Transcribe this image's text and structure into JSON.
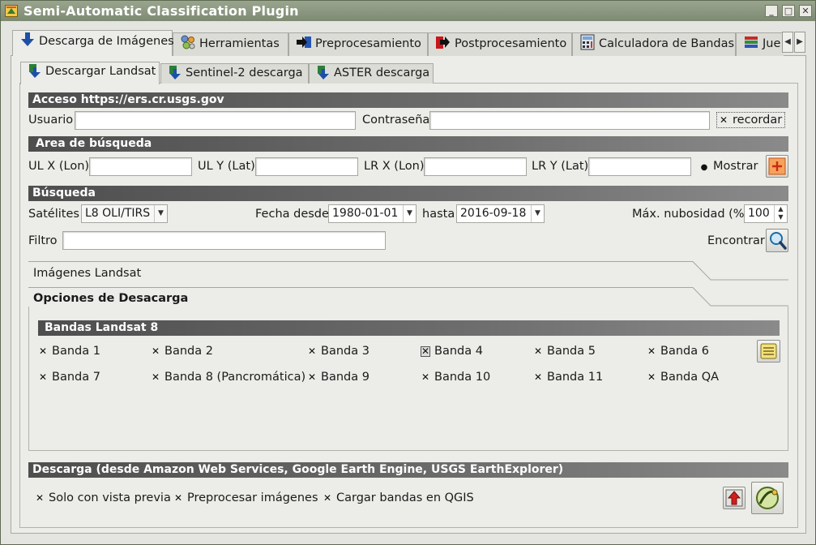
{
  "window": {
    "title": "Semi-Automatic Classification Plugin",
    "controls": [
      "_",
      "□",
      "✕"
    ]
  },
  "main_tabs": [
    {
      "label": "Descarga de Imágenes",
      "icon": "download-arrow-icon",
      "active": true
    },
    {
      "label": "Herramientas",
      "icon": "tools-icon"
    },
    {
      "label": "Preprocesamiento",
      "icon": "preprocessing-icon"
    },
    {
      "label": "Postprocesamiento",
      "icon": "postprocessing-icon"
    },
    {
      "label": "Calculadora de Bandas",
      "icon": "calculator-icon"
    },
    {
      "label": "Jue",
      "icon": "band-set-icon"
    }
  ],
  "sub_tabs": [
    {
      "label": "Descargar Landsat",
      "active": true
    },
    {
      "label": "Sentinel-2 descarga"
    },
    {
      "label": "ASTER descarga"
    }
  ],
  "access": {
    "header": "Acceso https://ers.cr.usgs.gov",
    "user_label": "Usuario",
    "user_value": "",
    "password_label": "Contraseña",
    "password_value": "",
    "remember_label": "recordar",
    "remember_checked": true
  },
  "search_area": {
    "header": "Area de búsqueda",
    "ulx_label": "UL X (Lon)",
    "uly_label": "UL Y (Lat)",
    "lrx_label": "LR X (Lon)",
    "lry_label": "LR Y (Lat)",
    "show_label": "Mostrar"
  },
  "search": {
    "header": "Búsqueda",
    "satellites_label": "Satélites",
    "satellite_value": "L8 OLI/TIRS",
    "date_from_label": "Fecha desde",
    "date_from_value": "1980-01-01",
    "until_label": "hasta",
    "until_value": "2016-09-18",
    "cloud_label": "Máx. nubosidad (%)",
    "cloud_value": "100",
    "filter_label": "Filtro",
    "filter_value": "",
    "find_label": "Encontrar"
  },
  "collapsibles": {
    "images_label": "Imágenes Landsat",
    "options_label": "Opciones de Desacarga"
  },
  "bands": {
    "header": "Bandas Landsat 8",
    "row1": [
      {
        "label": "Banda 1",
        "checked": true
      },
      {
        "label": "Banda 2",
        "checked": true
      },
      {
        "label": "Banda 3",
        "checked": true
      },
      {
        "label": "Banda 4",
        "checked": true,
        "focused": true
      },
      {
        "label": "Banda 5",
        "checked": true
      },
      {
        "label": "Banda 6",
        "checked": true
      }
    ],
    "row2": [
      {
        "label": "Banda 7",
        "checked": true
      },
      {
        "label": "Banda 8 (Pancromática)",
        "checked": true
      },
      {
        "label": "Banda 9",
        "checked": true
      },
      {
        "label": "Banda 10",
        "checked": true
      },
      {
        "label": "Banda 11",
        "checked": true
      },
      {
        "label": "Banda QA",
        "checked": true
      }
    ]
  },
  "download": {
    "header": "Descarga (desde Amazon Web Services, Google Earth Engine, USGS EarthExplorer)",
    "preview_only_label": "Solo con vista previa",
    "preprocess_label": "Preprocesar imágenes",
    "load_bands_label": "Cargar bandas en QGIS"
  },
  "colors": {
    "titlebar": "#8a9580",
    "section_bar": "#5c5c5c",
    "accent_orange": "#e8741c",
    "download_blue": "#1d4fa6",
    "red_arrow": "#d0201c"
  }
}
